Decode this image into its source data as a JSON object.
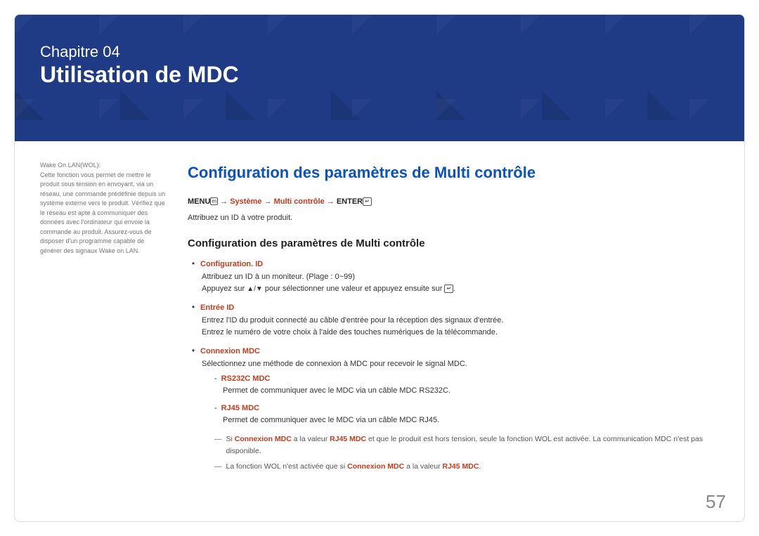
{
  "hero": {
    "chapter": "Chapitre 04",
    "title": "Utilisation de MDC"
  },
  "sidebar": {
    "wol_title": "Wake On LAN(WOL):",
    "wol_body": "Cette fonction vous permet de mettre le produit sous tension en envoyant, via un réseau, une commande prédéfinie depuis un système externe vers le produit. Vérifiez que le réseau est apte à communiquer des données avec l'ordinateur qui envoie la commande au produit. Assurez-vous de disposer d'un programme capable de générer des signaux Wake on LAN."
  },
  "main": {
    "section_title": "Configuration des paramètres de Multi contrôle",
    "breadcrumb": {
      "menu": "MENU",
      "menu_icon": "m",
      "arrow": "→",
      "systeme": "Système",
      "multi": "Multi contrôle",
      "enter": "ENTER",
      "enter_icon": "↵"
    },
    "attrib": "Attribuez un ID à votre produit.",
    "subheading": "Configuration des paramètres de Multi contrôle",
    "items": [
      {
        "title": "Configuration. ID",
        "line1": "Attribuez un ID à un moniteur. (Plage : 0~99)",
        "line2_pre": "Appuyez sur ",
        "line2_mid": " pour sélectionner une valeur et appuyez ensuite sur ",
        "line2_post": "."
      },
      {
        "title": "Entrée ID",
        "line1": "Entrez l'ID du produit connecté au câble d'entrée pour la réception des signaux d'entrée.",
        "line2": "Entrez le numéro de votre choix à l'aide des touches numériques de la télécommande."
      },
      {
        "title": "Connexion MDC",
        "line1": "Sélectionnez une méthode de connexion à MDC pour recevoir le signal MDC.",
        "sub": [
          {
            "title": "RS232C MDC",
            "body": "Permet de communiquer avec le MDC via un câble MDC RS232C."
          },
          {
            "title": "RJ45 MDC",
            "body": "Permet de communiquer avec le MDC via un câble MDC RJ45."
          }
        ]
      }
    ],
    "notes": {
      "n1_pre": "Si ",
      "n1_hl1": "Connexion MDC",
      "n1_mid1": " a la valeur ",
      "n1_hl2": "RJ45 MDC",
      "n1_post": " et que le produit est hors tension, seule la fonction WOL est activée. La communication MDC n'est pas disponible.",
      "n2_pre": "La fonction WOL n'est activée que si ",
      "n2_hl1": "Connexion MDC",
      "n2_mid": " a la valeur ",
      "n2_hl2": "RJ45 MDC",
      "n2_post": "."
    }
  },
  "page_number": "57"
}
